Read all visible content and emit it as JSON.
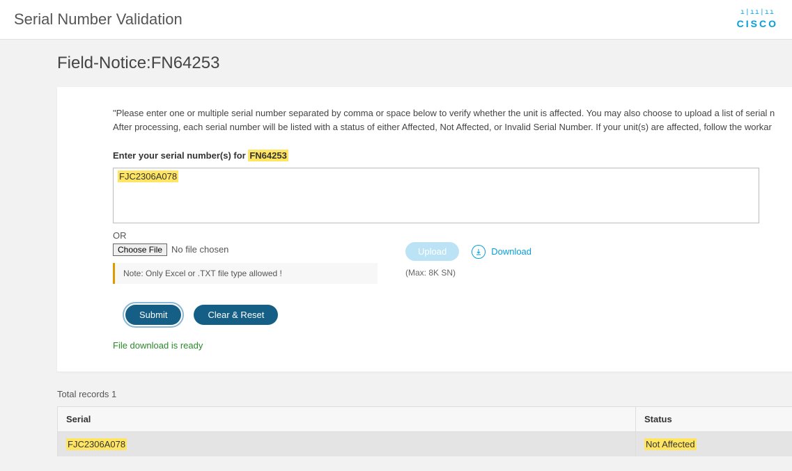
{
  "header": {
    "title": "Serial Number Validation",
    "logo_bars": "ı|ıı|ıı",
    "logo_text": "CISCO"
  },
  "field_notice": {
    "title": "Field-Notice:FN64253"
  },
  "card": {
    "intro": "\"Please enter one or multiple serial number separated by comma or space below to verify whether the unit is affected. You may also choose to upload a list of serial n",
    "intro2": "After processing, each serial number will be listed with a status of either Affected, Not Affected, or Invalid Serial Number. If your unit(s) are affected, follow the workar",
    "enter_label_prefix": "Enter your serial number(s) for ",
    "enter_label_fn": "FN64253",
    "serial_value": "FJC2306A078",
    "or_label": "OR",
    "choose_file_label": "Choose File",
    "no_file_label": "No file chosen",
    "note_text": "Note: Only Excel or .TXT file type allowed !",
    "upload_label": "Upload",
    "download_label": "Download",
    "max_label": "(Max: 8K SN)",
    "submit_label": "Submit",
    "clear_label": "Clear & Reset",
    "ready_text": "File download is ready"
  },
  "results": {
    "total_label": "Total records ",
    "total_count": "1",
    "headers": {
      "serial": "Serial",
      "status": "Status"
    },
    "rows": [
      {
        "serial": "FJC2306A078",
        "status": "Not Affected"
      }
    ]
  }
}
